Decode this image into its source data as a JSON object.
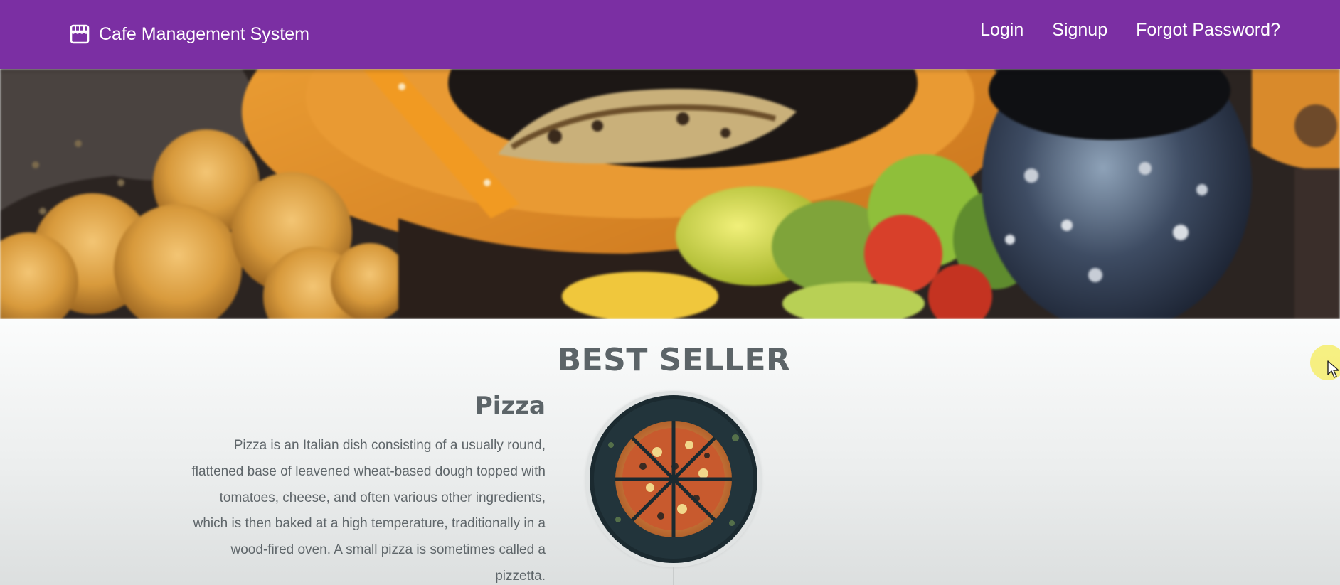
{
  "navbar": {
    "brand_icon": "store-icon",
    "brand_label": "Cafe Management System",
    "background_color": "#7b2fa3",
    "links": [
      {
        "label": "Login"
      },
      {
        "label": "Signup"
      },
      {
        "label": "Forgot Password?"
      }
    ]
  },
  "hero": {
    "image": "food-banner-photo"
  },
  "best_seller": {
    "title": "BEST SELLER",
    "product": {
      "name": "Pizza",
      "description": "Pizza is an Italian dish consisting of a usually round, flattened base of leavened wheat-based dough topped with tomatoes, cheese, and often various other ingredients, which is then baked at a high temperature, traditionally in a wood-fired oven. A small pizza is sometimes called a pizzetta.",
      "image": "pizza-photo"
    }
  },
  "cursor": {
    "icon": "mouse-pointer-icon",
    "highlight_color": "#f6ec5a"
  }
}
